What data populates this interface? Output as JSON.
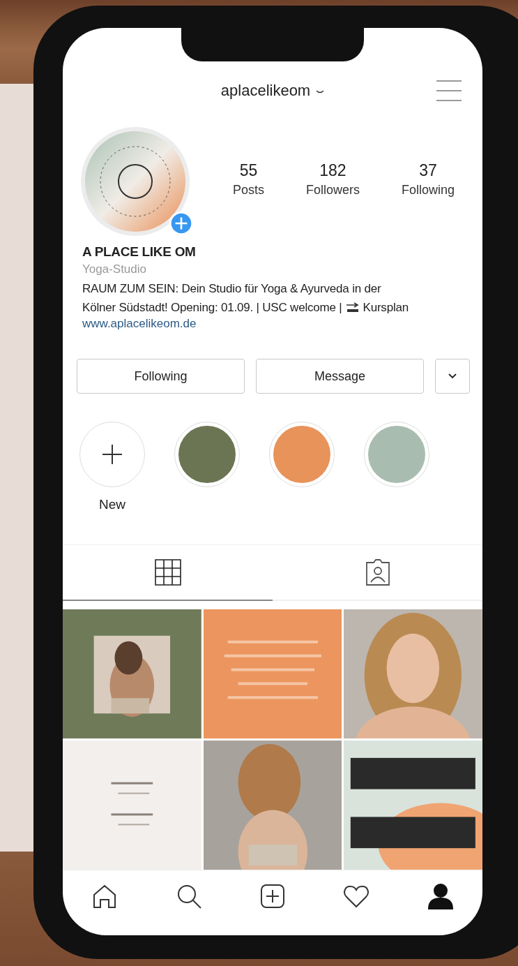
{
  "header": {
    "username": "aplacelikeom"
  },
  "profile": {
    "stats": [
      {
        "value": "55",
        "label": "Posts"
      },
      {
        "value": "182",
        "label": "Followers"
      },
      {
        "value": "37",
        "label": "Following"
      }
    ],
    "name": "A PLACE LIKE OM",
    "category": "Yoga-Studio",
    "bio_lines": [
      "RAUM ZUM SEIN: Dein Studio für Yoga & Ayurveda in der",
      "Kölner Südstadt! Opening: 01.09. | USC welcome |"
    ],
    "bio_after_icon": "Kursplan",
    "website": "www.aplacelikeom.de"
  },
  "actions": [
    {
      "kind": "text",
      "label": "Following"
    },
    {
      "kind": "text",
      "label": "Message"
    },
    {
      "kind": "dropdown"
    }
  ],
  "highlights": [
    {
      "kind": "new",
      "label": "New"
    },
    {
      "kind": "color",
      "color": "#6b7553"
    },
    {
      "kind": "color",
      "color": "#e8935a"
    },
    {
      "kind": "color",
      "color": "#a9bcb0"
    }
  ],
  "tabs": [
    {
      "kind": "grid",
      "selected": true
    },
    {
      "kind": "tagged",
      "selected": false
    }
  ],
  "nav": [
    {
      "kind": "home",
      "selected": false
    },
    {
      "kind": "search",
      "selected": false
    },
    {
      "kind": "add",
      "selected": false
    },
    {
      "kind": "heart",
      "selected": false
    },
    {
      "kind": "profile",
      "selected": true
    }
  ]
}
